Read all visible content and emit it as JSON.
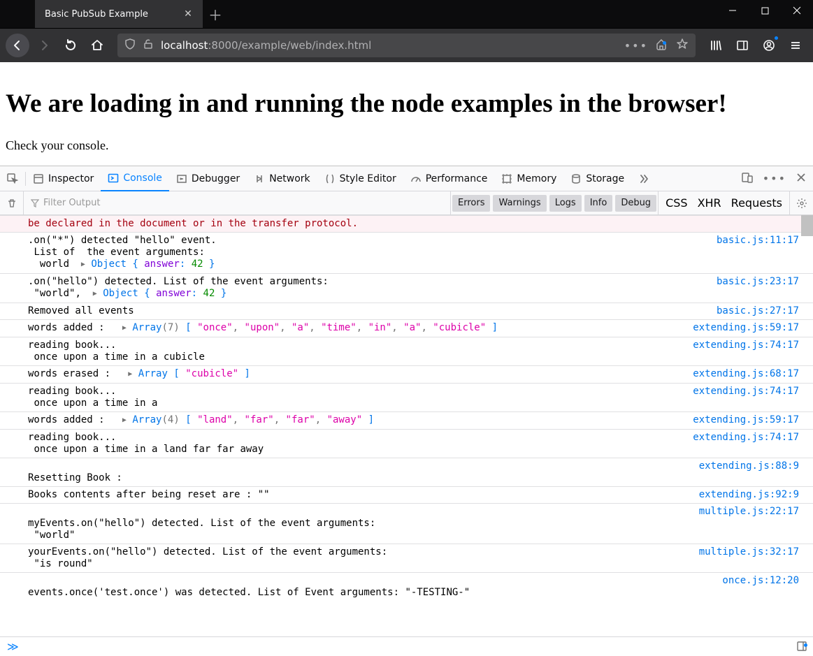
{
  "window": {
    "tab_title": "Basic PubSub Example"
  },
  "url": {
    "host": "localhost",
    "rest": ":8000/example/web/index.html"
  },
  "page": {
    "heading": "We are loading in and running the node examples in the browser!",
    "sub": "Check your console."
  },
  "devtools": {
    "tabs": {
      "inspector": "Inspector",
      "console": "Console",
      "debugger": "Debugger",
      "network": "Network",
      "style": "Style Editor",
      "perf": "Performance",
      "memory": "Memory",
      "storage": "Storage"
    },
    "filter_placeholder": "Filter Output",
    "toggles": {
      "errors": "Errors",
      "warnings": "Warnings",
      "logs": "Logs",
      "info": "Info",
      "debug": "Debug",
      "css": "CSS",
      "xhr": "XHR",
      "requests": "Requests"
    }
  },
  "console_lines": {
    "warn_tail": "be declared in the document or in the transfer protocol.",
    "l1": {
      "body": ".on(\"*\") detected \"hello\" event.\n List of  the event arguments:\n  world ",
      "obj_lbl": "Object",
      "obj_k": "answer",
      "obj_v": "42",
      "loc": "basic.js:11:17"
    },
    "l2": {
      "body": ".on(\"hello\") detected. List of the event arguments:\n \"world\", ",
      "obj_lbl": "Object",
      "obj_k": "answer",
      "obj_v": "42",
      "loc": "basic.js:23:17"
    },
    "l3": {
      "body": "Removed all events",
      "loc": "basic.js:27:17"
    },
    "l4": {
      "pre": "words added :  ",
      "arr_lbl": "Array",
      "arr_n": "(7)",
      "items": [
        "\"once\"",
        "\"upon\"",
        "\"a\"",
        "\"time\"",
        "\"in\"",
        "\"a\"",
        "\"cubicle\""
      ],
      "loc": "extending.js:59:17"
    },
    "l5": {
      "body": "reading book...\n once upon a time in a cubicle",
      "loc": "extending.js:74:17"
    },
    "l6": {
      "pre": "words erased :  ",
      "arr_lbl": "Array",
      "items": [
        "\"cubicle\""
      ],
      "loc": "extending.js:68:17"
    },
    "l7": {
      "body": "reading book...\n once upon a time in a",
      "loc": "extending.js:74:17"
    },
    "l8": {
      "pre": "words added :  ",
      "arr_lbl": "Array",
      "arr_n": "(4)",
      "items": [
        "\"land\"",
        "\"far\"",
        "\"far\"",
        "\"away\""
      ],
      "loc": "extending.js:59:17"
    },
    "l9": {
      "body": "reading book...\n once upon a time in a land far far away",
      "loc": "extending.js:74:17"
    },
    "l10": {
      "body": "\nResetting Book :",
      "loc": "extending.js:88:9"
    },
    "l11": {
      "body": "Books contents after being reset are : \"\"",
      "loc": "extending.js:92:9"
    },
    "l12": {
      "body": "\nmyEvents.on(\"hello\") detected. List of the event arguments:\n \"world\"",
      "loc": "multiple.js:22:17"
    },
    "l13": {
      "body": "yourEvents.on(\"hello\") detected. List of the event arguments:\n \"is round\"",
      "loc": "multiple.js:32:17"
    },
    "l14": {
      "body": "\nevents.once('test.once') was detected. List of Event arguments: \"-TESTING-\"",
      "loc": "once.js:12:20"
    }
  }
}
